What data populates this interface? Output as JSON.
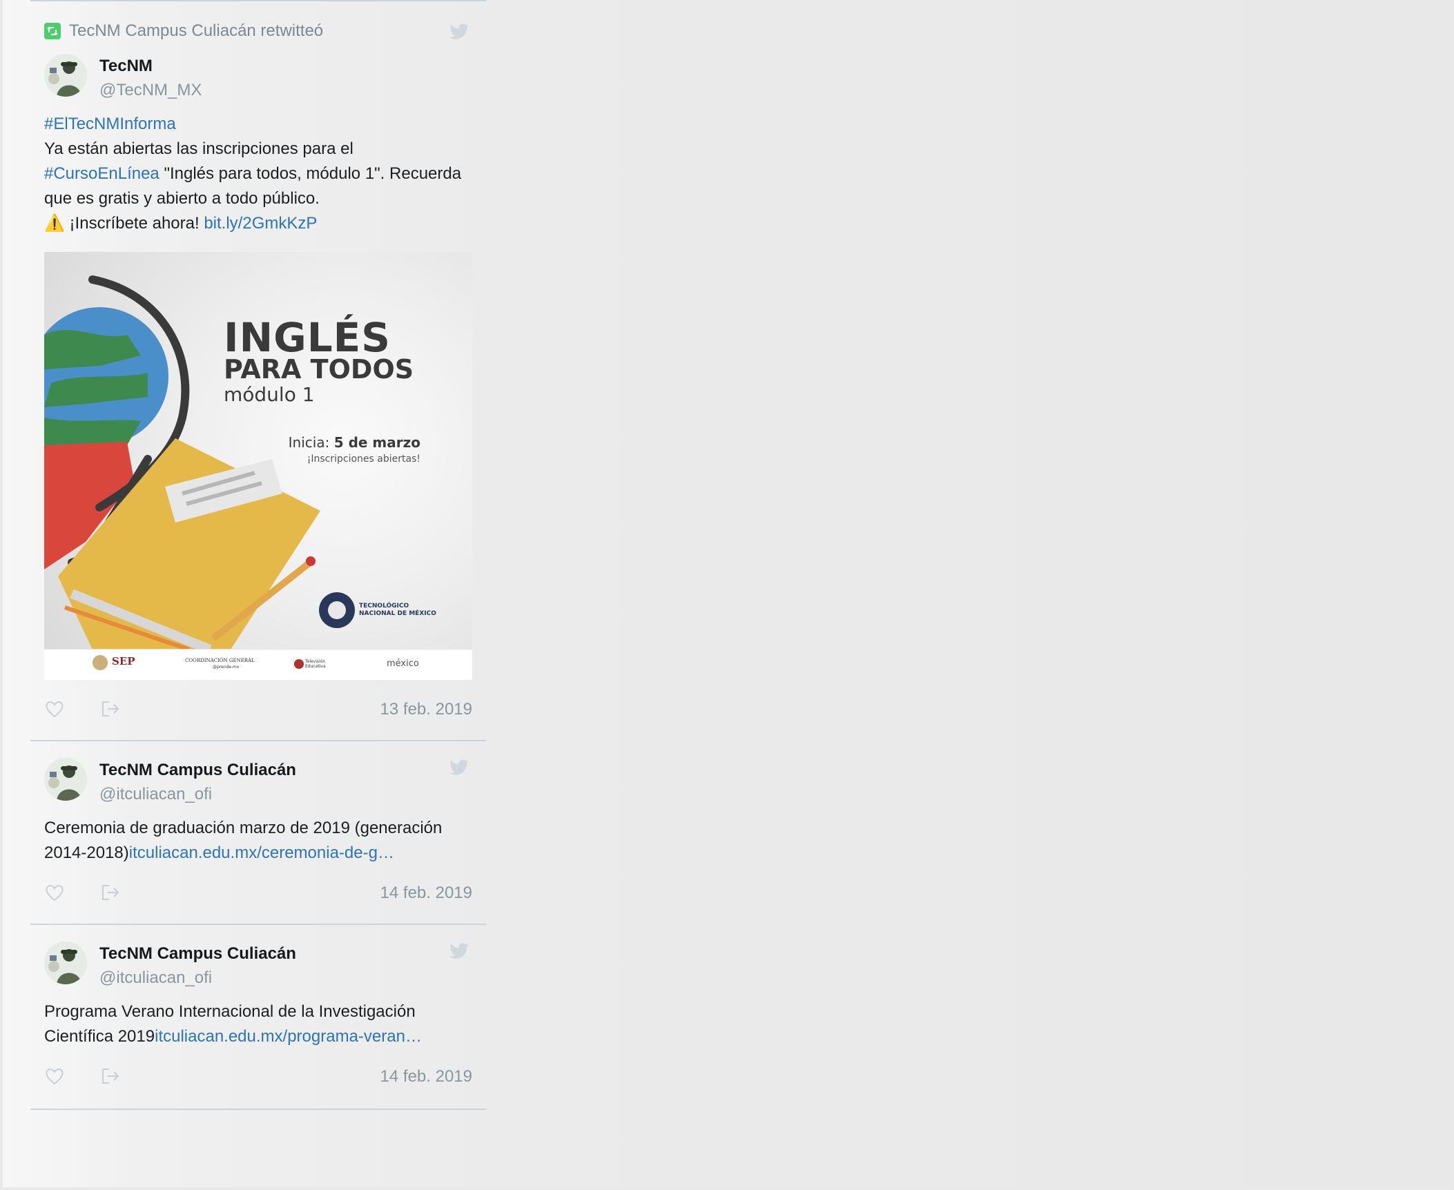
{
  "tweets": [
    {
      "retweet_notice": "TecNM Campus Culiacán retwitteó",
      "name": "TecNM",
      "handle": "@TecNM_MX",
      "hashtag_line": "#ElTecNMInforma",
      "text_line1": "Ya están abiertas las inscripciones para el",
      "hashtag2": "#CursoEnLínea",
      "text_line2_rest": " \"Inglés para todos, módulo 1\". Recuerda",
      "text_line3": "que es gratis y abierto a todo público.",
      "warning_emoji": "⚠️",
      "cta": " ¡Inscríbete ahora! ",
      "short_link": "bit.ly/2GmkKzP",
      "image": {
        "title": "INGLÉS",
        "subtitle": "PARA TODOS",
        "module": "módulo 1",
        "start_label": "Inicia: ",
        "start_date": "5 de marzo",
        "enroll": "¡Inscripciones abiertas!",
        "logo_line1": "TECNOLÓGICO",
        "logo_line2": "NACIONAL DE MÉXICO",
        "footer_sep": "SEP",
        "footer_cg": "COORDINACIÓN GENERAL",
        "footer_cg2": "@prende.mx",
        "footer_tv": "Televisión Educativa",
        "footer_mx": "méxico"
      },
      "date": "13 feb. 2019"
    },
    {
      "name": "TecNM Campus Culiacán",
      "handle": "@itculiacan_ofi",
      "text_line1": "Ceremonia de graduación marzo de 2019 (generación",
      "text_line2": "2014-2018)",
      "link": "itculiacan.edu.mx/ceremonia-de-g…",
      "date": "14 feb. 2019"
    },
    {
      "name": "TecNM Campus Culiacán",
      "handle": "@itculiacan_ofi",
      "text_line1": "Programa Verano Internacional de la Investigación",
      "text_line2": "Científica 2019",
      "link": "itculiacan.edu.mx/programa-veran…",
      "date": "14 feb. 2019"
    }
  ],
  "icons": {
    "retweet": "retweet-icon",
    "like": "heart-icon",
    "share": "share-icon",
    "twitter": "twitter-bird-icon"
  },
  "colors": {
    "link": "#2b73ba",
    "retweet_green": "#4ccf6a",
    "muted": "#8a959e"
  }
}
